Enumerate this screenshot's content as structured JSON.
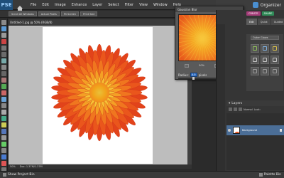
{
  "menu": {
    "logo": "PSE",
    "items": [
      "File",
      "Edit",
      "Image",
      "Enhance",
      "Layer",
      "Select",
      "Filter",
      "View",
      "Window",
      "Help"
    ],
    "organizer_label": "Organizer"
  },
  "options": {
    "segments": [
      "Scroll All Windows",
      "Actual Pixels",
      "Fit Screen",
      "Print Size"
    ]
  },
  "document": {
    "tab_title": "Untitled-1.jpg @ 50% (RGB/8)",
    "zoom_status": "50%",
    "doc_info": "Doc: 1.37M/1.37M"
  },
  "dialog": {
    "title": "Gaussian Blur",
    "ok_label": "OK",
    "cancel_label": "Cancel",
    "preview_label": "Preview",
    "preview_checked": "✓",
    "zoom_value": "50%",
    "radius_label": "Radius:",
    "radius_value": "4.0",
    "radius_unit": "pixels",
    "radius_slider_fraction": 0.23
  },
  "panel": {
    "modes": [
      "CREATE",
      "SHARE"
    ],
    "tabs": [
      "Edit",
      "Quick",
      "Guided"
    ],
    "effects_select": "Outer Glows",
    "layers_title": "Layers",
    "layers_mode": "Normal",
    "layers_lock": "Lock:",
    "layer_name": "Background"
  },
  "bottom": {
    "left_label": "Show Project Bin",
    "right_label": "Palette Bin"
  },
  "colors": {
    "accent": "#2d6cc1",
    "create": "#a63d7a",
    "share": "#2e8b57",
    "layer_selected": "#4b6e97"
  }
}
